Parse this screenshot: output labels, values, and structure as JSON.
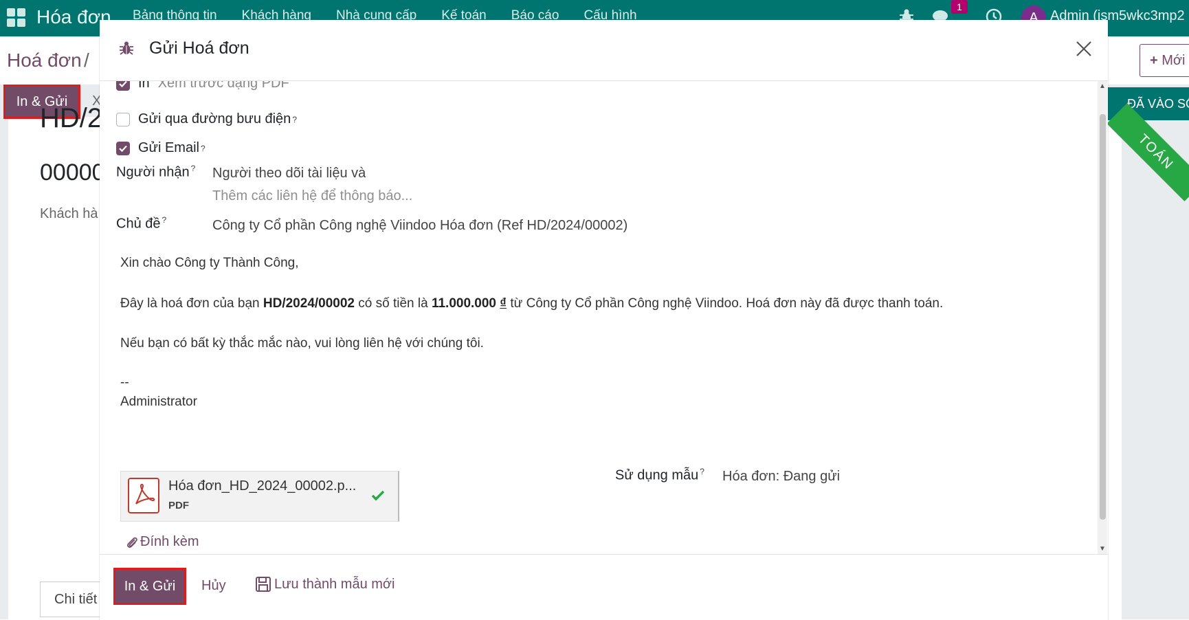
{
  "topbar": {
    "app_name": "Hóa đơn",
    "menu": [
      "Bảng thông tin",
      "Khách hàng",
      "Nhà cung cấp",
      "Kế toán",
      "Báo cáo",
      "Cấu hình"
    ],
    "message_count": "1",
    "avatar_letter": "A",
    "user_name": "Admin (ism5wkc3mp2"
  },
  "background": {
    "breadcrumb": "Hoá đơn",
    "breadcrumb_sep": "/",
    "new_button": "Mới",
    "print_send_button": "In & Gửi",
    "second_action": "X",
    "status": "ĐÃ VÀO SỔ",
    "ribbon": "TOÁN",
    "title_fragment": "HD/2",
    "number_fragment": "00000",
    "customer_label": "Khách hà",
    "tab_label": "Chi tiết"
  },
  "modal": {
    "title": "Gửi Hoá đơn",
    "options": {
      "print_label": "In",
      "print_hint": "Xem trước dạng PDF",
      "post_label": "Gửi qua đường bưu điện",
      "email_label": "Gửi Email"
    },
    "recipients": {
      "label": "Người nhận",
      "value": "Người theo dõi tài liệu và",
      "placeholder": "Thêm các liên hệ để thông báo..."
    },
    "subject": {
      "label": "Chủ đề",
      "value": "Công ty Cổ phần Công nghệ Viindoo Hóa đơn (Ref HD/2024/00002)"
    },
    "body": {
      "greeting": "Xin chào Công ty Thành Công,",
      "line1_a": "Đây là hoá đơn của bạn ",
      "line1_invoice": "HD/2024/00002",
      "line1_b": " có số tiền là ",
      "line1_amount": "11.000.000",
      "line1_currency": "₫",
      "line1_c": " từ Công ty Cổ phần Công nghệ Viindoo. Hoá đơn này đã được thanh toán.",
      "line2": "Nếu bạn có bất kỳ thắc mắc nào, vui lòng liên hệ với chúng tôi.",
      "signature_sep": "--",
      "signature": "Administrator"
    },
    "attachment": {
      "name": "Hóa đơn_HD_2024_00002.p...",
      "type": "PDF"
    },
    "attach_link": "Đính kèm",
    "template": {
      "label": "Sử dụng mẫu",
      "value": "Hóa đơn: Đang gửi"
    },
    "footer": {
      "primary": "In & Gửi",
      "cancel": "Hủy",
      "save_template": "Lưu thành mẫu mới"
    }
  },
  "colors": {
    "brand": "#714b67",
    "topbar": "#00756f",
    "highlight": "#e01b1b"
  }
}
